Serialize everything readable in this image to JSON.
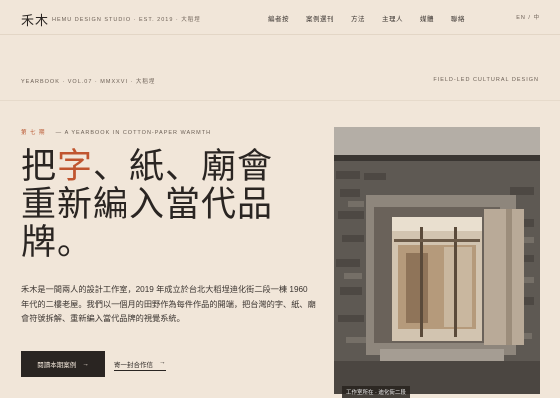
{
  "header": {
    "logo": "禾木",
    "logo_sub": "HEMU DESIGN STUDIO · EST. 2019 · 大稻埕",
    "nav": [
      "編者按",
      "案例選刊",
      "方法",
      "主理人",
      "媒體",
      "聯絡"
    ],
    "lang": "EN / 中"
  },
  "meta": {
    "left": "YEARBOOK · VOL.07 · MMXXVI · 大稻埕",
    "right": "FIELD-LED CULTURAL DESIGN"
  },
  "issue": {
    "num": "第 七 期",
    "label": "A YEARBOOK IN COTTON-PAPER WARMTH"
  },
  "headline": {
    "pre": "把",
    "accent": "字",
    "post1": "、紙、廟會",
    "line2": "重新編入當代品",
    "line3": "牌。"
  },
  "intro": "禾木是一間兩人的設計工作室，2019 年成立於台北大稻埕迪化街二段一棟 1960 年代的二樓老屋。我們以一個月的田野作為每件作品的開端，把台灣的字、紙、廟會符號拆解、重新編入當代品牌的視覺系統。",
  "cta": {
    "primary": "閱讀本期案例",
    "secondary": "寄一封合作信",
    "arrow": "→"
  },
  "photo": {
    "caption": "工作室所在 · 迪化街二段"
  },
  "colors": {
    "background": "#f1e6d9",
    "ink": "#2a2522",
    "accent": "#c0552f"
  }
}
